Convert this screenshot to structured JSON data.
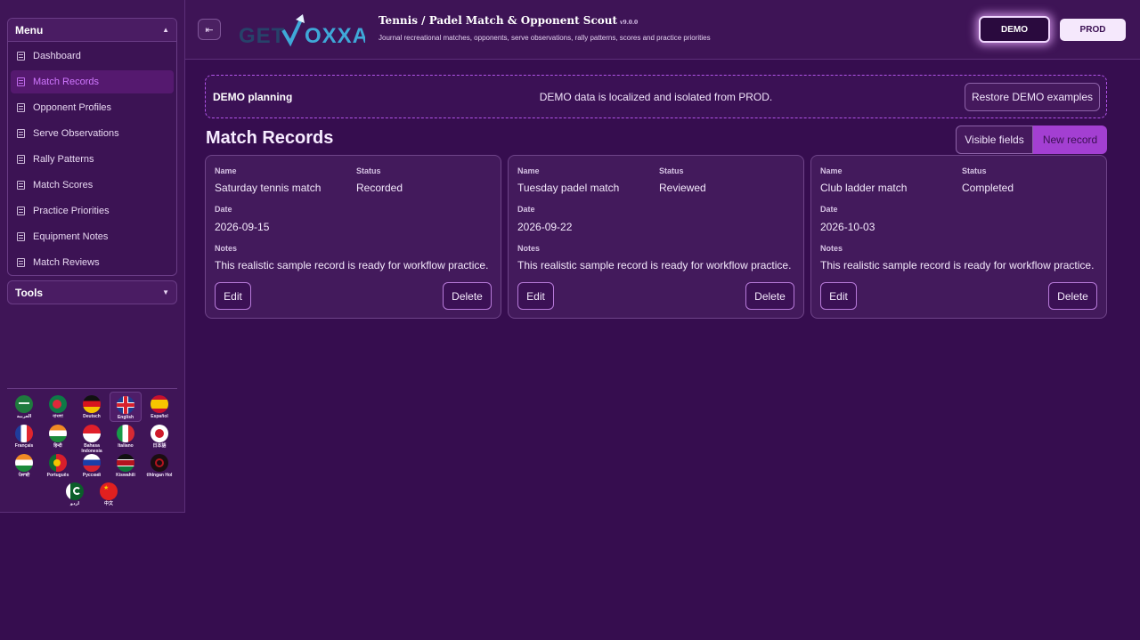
{
  "sidebar": {
    "menu_label": "Menu",
    "items": [
      {
        "label": "Dashboard",
        "active": false
      },
      {
        "label": "Match Records",
        "active": true
      },
      {
        "label": "Opponent Profiles",
        "active": false
      },
      {
        "label": "Serve Observations",
        "active": false
      },
      {
        "label": "Rally Patterns",
        "active": false
      },
      {
        "label": "Match Scores",
        "active": false
      },
      {
        "label": "Practice Priorities",
        "active": false
      },
      {
        "label": "Equipment Notes",
        "active": false
      },
      {
        "label": "Match Reviews",
        "active": false
      }
    ],
    "tools_label": "Tools",
    "languages": [
      {
        "label": "العربية",
        "flag": "saudi-arabia-flag"
      },
      {
        "label": "বাংলা",
        "flag": "bangladesh-flag"
      },
      {
        "label": "Deutsch",
        "flag": "germany-flag"
      },
      {
        "label": "English",
        "flag": "uk-flag",
        "selected": true
      },
      {
        "label": "Español",
        "flag": "spain-flag"
      },
      {
        "label": "Français",
        "flag": "france-flag"
      },
      {
        "label": "हिन्दी",
        "flag": "india-flag"
      },
      {
        "label": "Bahasa Indonesia",
        "flag": "indonesia-flag"
      },
      {
        "label": "Italiano",
        "flag": "italy-flag"
      },
      {
        "label": "日本語",
        "flag": "japan-flag"
      },
      {
        "label": "ਪੰਜਾਬੀ",
        "flag": "india-flag"
      },
      {
        "label": "Português",
        "flag": "portugal-flag"
      },
      {
        "label": "Русский",
        "flag": "russia-flag"
      },
      {
        "label": "Kiswahili",
        "flag": "kenya-flag"
      },
      {
        "label": "tlhIngan Hol",
        "flag": "klingon-flag"
      },
      {
        "label": "اردو",
        "flag": "pakistan-flag"
      },
      {
        "label": "中文",
        "flag": "china-flag"
      }
    ]
  },
  "header": {
    "logo_text": "GETVOXXA",
    "title": "Tennis / Padel Match & Opponent Scout",
    "version": "v9.0.0",
    "subtitle": "Journal recreational matches, opponents, serve observations, rally patterns, scores and practice priorities",
    "env_demo": "DEMO",
    "env_prod": "PROD"
  },
  "banner": {
    "title": "DEMO planning",
    "note": "DEMO data is localized and isolated from PROD.",
    "restore_label": "Restore DEMO examples"
  },
  "main": {
    "page_title": "Match Records",
    "visible_fields_label": "Visible fields",
    "new_record_label": "New record",
    "field_labels": {
      "name": "Name",
      "status": "Status",
      "date": "Date",
      "notes": "Notes"
    },
    "edit_label": "Edit",
    "delete_label": "Delete",
    "records": [
      {
        "name": "Saturday tennis match",
        "status": "Recorded",
        "date": "2026-09-15",
        "notes": "This realistic sample record is ready for workflow practice."
      },
      {
        "name": "Tuesday padel match",
        "status": "Reviewed",
        "date": "2026-09-22",
        "notes": "This realistic sample record is ready for workflow practice."
      },
      {
        "name": "Club ladder match",
        "status": "Completed",
        "date": "2026-10-03",
        "notes": "This realistic sample record is ready for workflow practice."
      }
    ]
  },
  "colors": {
    "background": "#360d4f",
    "accent": "#a33fd2",
    "active_text": "#d078ff"
  }
}
